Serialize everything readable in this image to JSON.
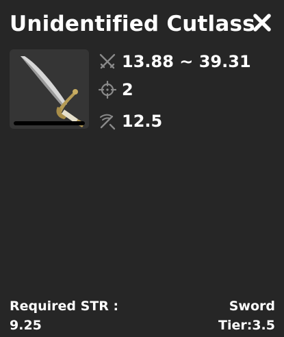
{
  "item": {
    "title": "Unidentified Cutlass",
    "image": "cutlass-image",
    "close_icon": "close-icon"
  },
  "stats": [
    {
      "icon": "crossed-swords-icon",
      "value": "13.88 ~ 39.31"
    },
    {
      "icon": "crosshair-icon",
      "value": "2"
    },
    {
      "icon": "weapon-speed-icon",
      "value": "12.5"
    }
  ],
  "footer": {
    "req_label": "Required STR :",
    "req_value": "9.25",
    "type": "Sword",
    "tier": "Tier:3.5"
  },
  "colors": {
    "background": "#262626",
    "thumb_background": "#353535",
    "text": "#ffffff",
    "icon": "#8a8a8a"
  }
}
